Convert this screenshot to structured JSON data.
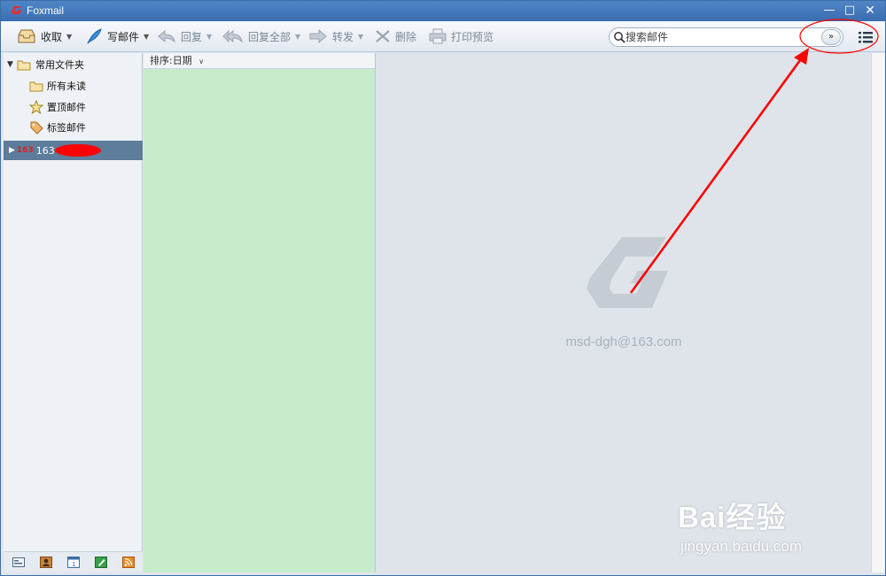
{
  "window": {
    "title": "Foxmail"
  },
  "toolbar": {
    "receive_label": "收取",
    "compose_label": "写邮件",
    "reply_label": "回复",
    "reply_all_label": "回复全部",
    "forward_label": "转发",
    "delete_label": "删除",
    "print_preview_label": "打印预览",
    "search_placeholder": "搜索邮件"
  },
  "sidebar": {
    "common_folders_label": "常用文件夹",
    "items": [
      {
        "label": "所有未读",
        "icon": "folder-icon"
      },
      {
        "label": "置顶邮件",
        "icon": "star-icon"
      },
      {
        "label": "标签邮件",
        "icon": "tag-icon"
      }
    ],
    "account_badge": "163",
    "account_label_partial": "163"
  },
  "mail_list": {
    "sort_label": "排序:日期"
  },
  "reading_pane": {
    "account_email": "msd-dgh@163.com"
  },
  "watermark": {
    "brand": "Bai经验",
    "url": "jingyan.baidu.com"
  },
  "colors": {
    "title_bar": "#3f75b8",
    "mail_list_bg": "#c7ebcb",
    "reading_bg": "#dfe4ea",
    "selected_account": "#5e7c9b",
    "annotation_red": "#ff0000"
  }
}
